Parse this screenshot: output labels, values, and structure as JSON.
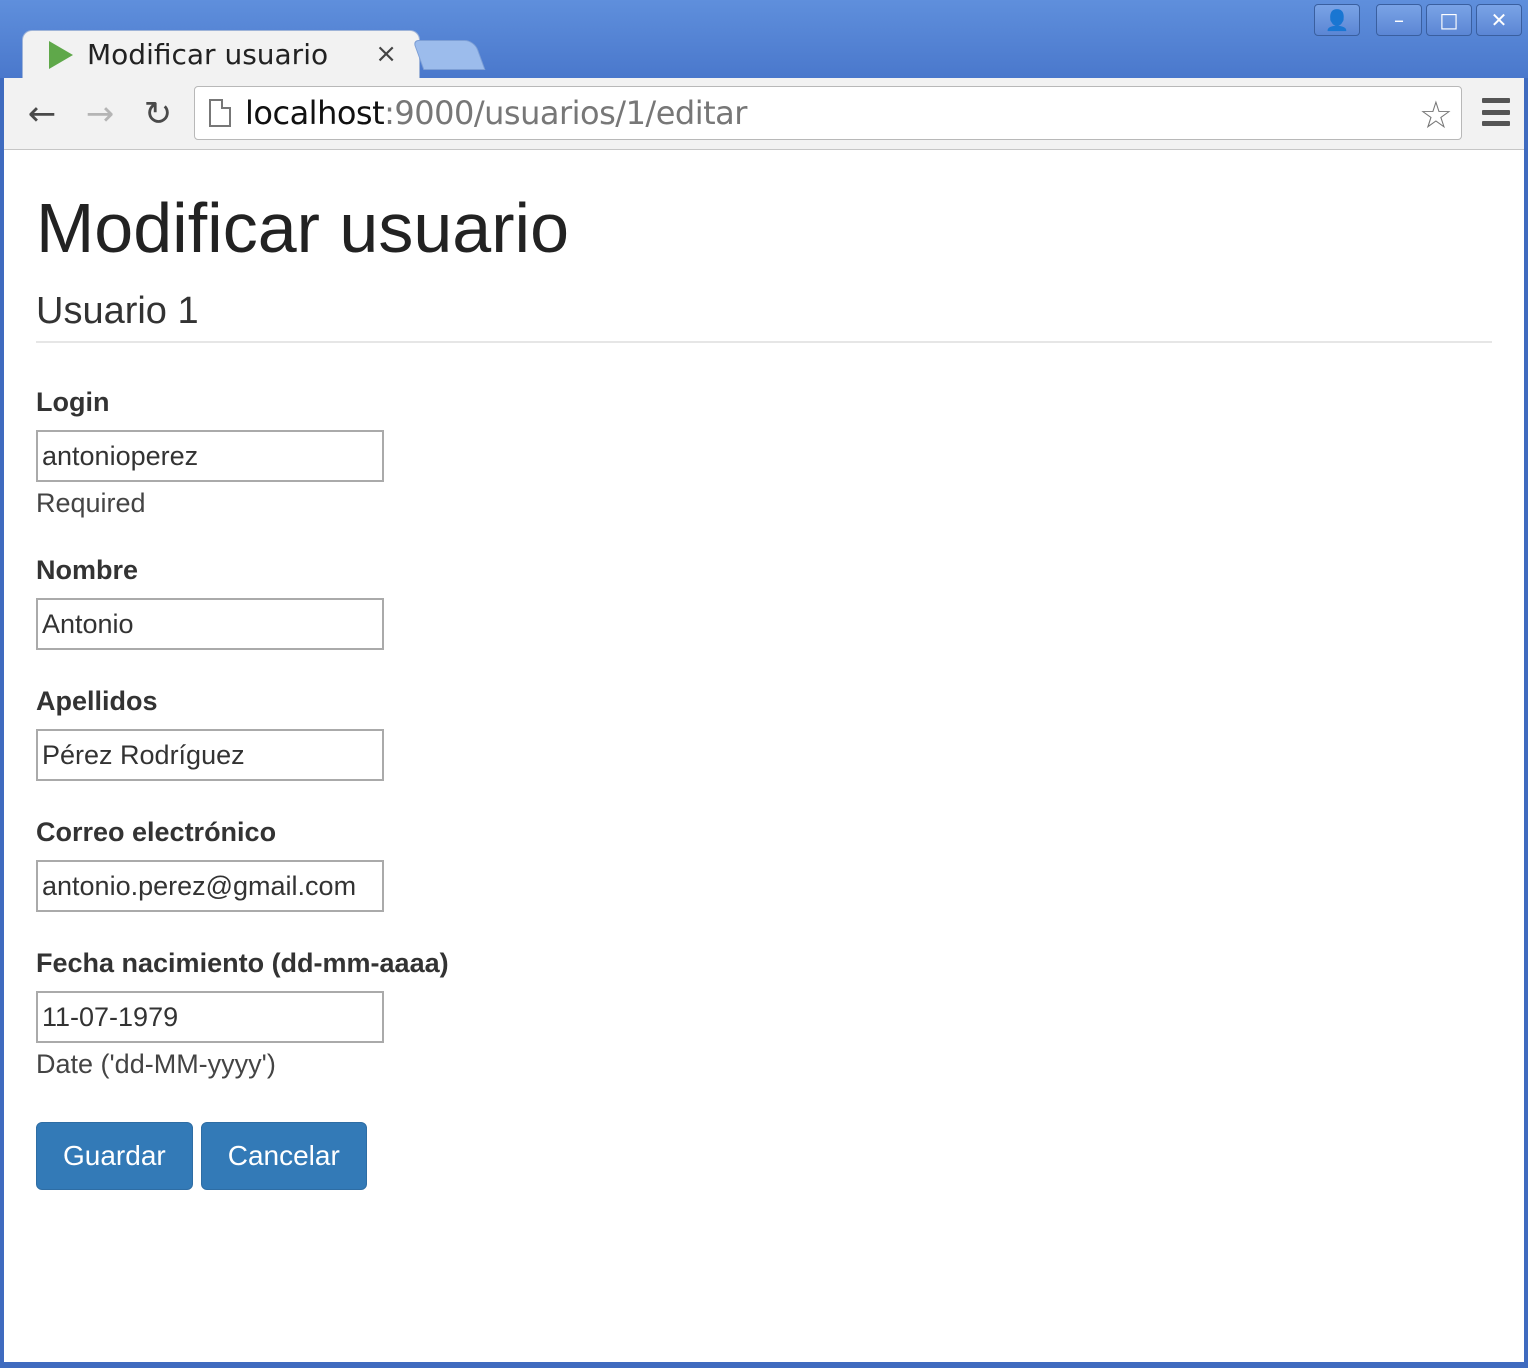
{
  "window": {
    "tab_title": "Modificar usuario",
    "tab_close": "×",
    "controls": {
      "profile": "👤",
      "minimize": "–",
      "maximize": "□",
      "close": "✕"
    }
  },
  "toolbar": {
    "back_icon": "←",
    "forward_icon": "→",
    "reload_icon": "↻",
    "url_host": "localhost",
    "url_path": ":9000/usuarios/1/editar",
    "star_icon": "☆"
  },
  "page": {
    "title": "Modificar usuario",
    "subtitle": "Usuario 1"
  },
  "form": {
    "fields": [
      {
        "label": "Login",
        "value": "antonioperez",
        "help": "Required"
      },
      {
        "label": "Nombre",
        "value": "Antonio",
        "help": ""
      },
      {
        "label": "Apellidos",
        "value": "Pérez Rodríguez",
        "help": ""
      },
      {
        "label": "Correo electrónico",
        "value": "antonio.perez@gmail.com",
        "help": ""
      },
      {
        "label": "Fecha nacimiento (dd-mm-aaaa)",
        "value": "11-07-1979",
        "help": "Date ('dd-MM-yyyy')"
      }
    ],
    "save_label": "Guardar",
    "cancel_label": "Cancelar"
  },
  "colors": {
    "primary_button": "#337ab7",
    "titlebar": "#4a78cc"
  }
}
